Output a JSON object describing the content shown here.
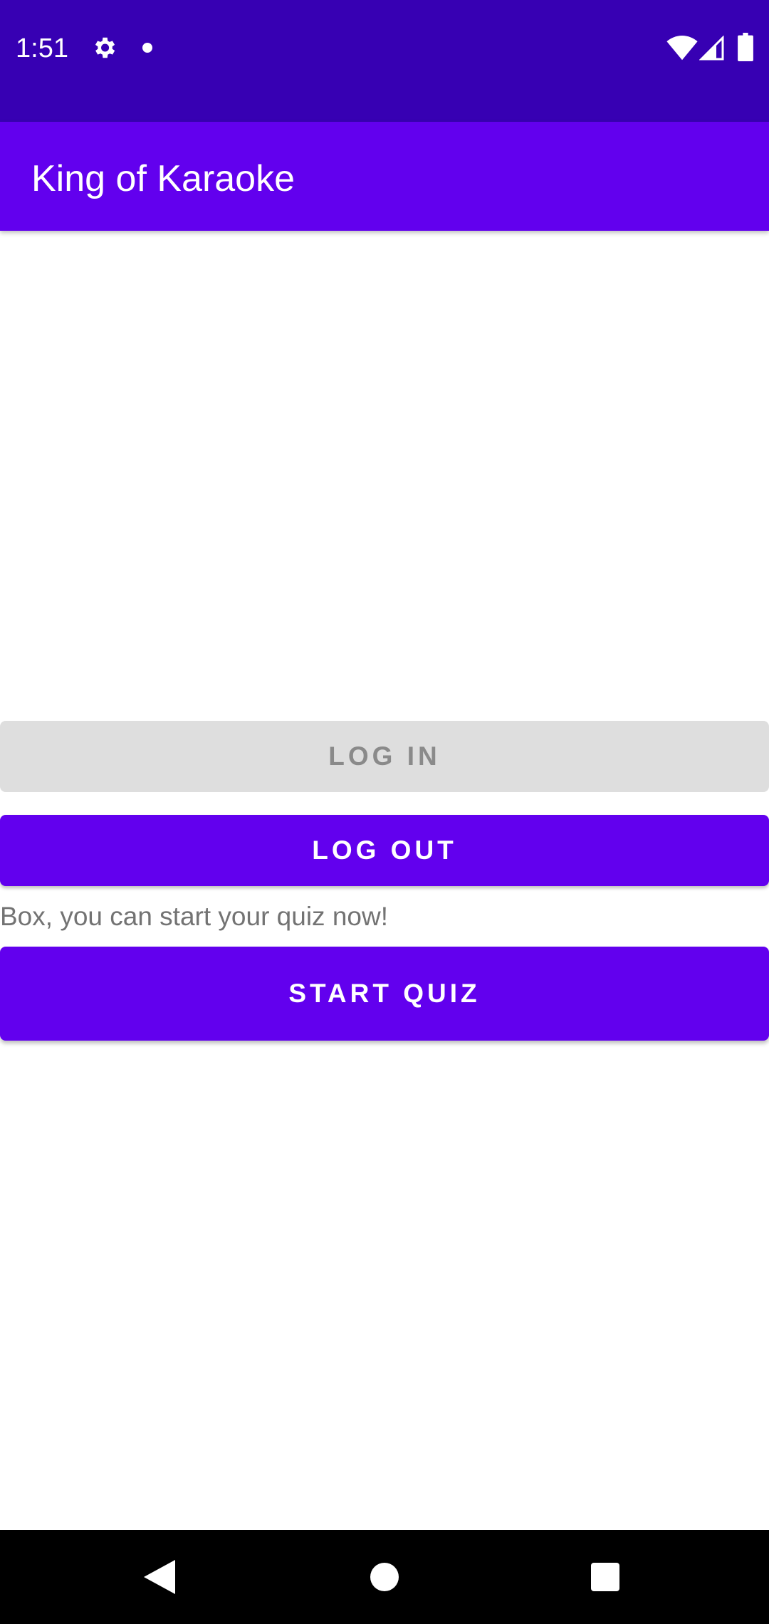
{
  "status_bar": {
    "time": "1:51",
    "icons": [
      "gear-icon",
      "notification-dot-icon",
      "wifi-icon",
      "signal-icon",
      "battery-icon"
    ]
  },
  "app_bar": {
    "title": "King of Karaoke",
    "color": "#6200ee"
  },
  "main": {
    "login_label": "LOG IN",
    "logout_label": "LOG OUT",
    "info_text": "Box, you can start your quiz now!",
    "start_quiz_label": "START QUIZ"
  },
  "nav_bar": {
    "icons": [
      "back-icon",
      "home-icon",
      "recents-icon"
    ]
  },
  "colors": {
    "status_bar": "#3700b3",
    "primary": "#6200ee",
    "disabled_button": "#dedede"
  }
}
